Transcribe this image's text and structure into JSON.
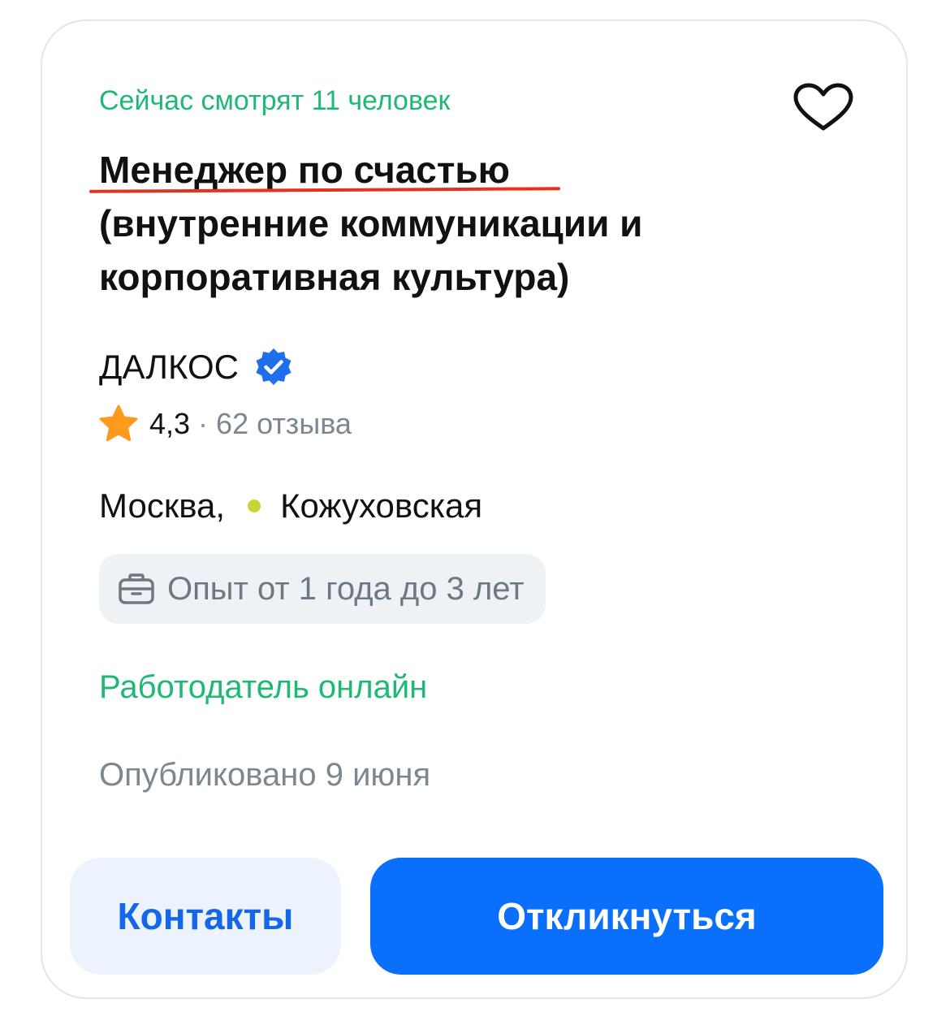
{
  "card": {
    "viewers_text": "Сейчас смотрят 11 человек",
    "favorite_icon": "heart-outline-icon",
    "title": {
      "main": "Менеджер по счастью",
      "line2": "(внутренние коммуникации и",
      "line3": "корпоративная культура)"
    },
    "company": {
      "name": "ДАЛКОС",
      "verified_icon": "verified-badge-icon"
    },
    "rating": {
      "star_icon": "star-icon",
      "value": "4,3",
      "separator": "·",
      "reviews": "62 отзыва"
    },
    "location": {
      "city": "Москва,",
      "metro_station": "Кожуховская",
      "metro_icon": "metro-dot-icon"
    },
    "experience": {
      "icon": "briefcase-icon",
      "text": "Опыт от 1 года до 3 лет"
    },
    "employer_status": "Работодатель онлайн",
    "published": "Опубликовано 9 июня",
    "buttons": {
      "contacts": "Контакты",
      "apply": "Откликнуться"
    }
  },
  "colors": {
    "green": "#1fb874",
    "blue": "#0a6ffb",
    "underline_red": "#e5321e",
    "star_orange": "#ff9a1f",
    "metro_line": "#c6d637"
  }
}
